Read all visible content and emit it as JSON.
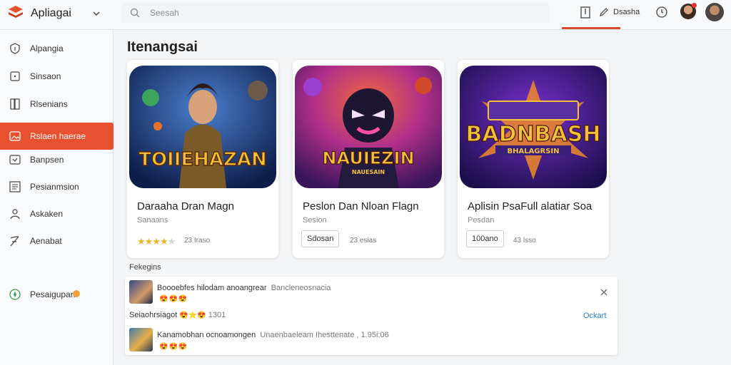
{
  "app": {
    "name": "Apliagai"
  },
  "search": {
    "placeholder": "Seesah"
  },
  "toolbar": {
    "action_label": "Dsasha"
  },
  "sidebar": {
    "items": [
      {
        "label": "Alpangia",
        "icon": "info-shield-icon"
      },
      {
        "label": "Sinsaon",
        "icon": "info-square-icon"
      },
      {
        "label": "Rlsenians",
        "icon": "book-icon"
      },
      {
        "label": "Rslaen haerae",
        "icon": "image-icon",
        "active": true
      },
      {
        "label": "Banpsen",
        "icon": "message-square-icon"
      },
      {
        "label": "Pesianmsion",
        "icon": "document-list-icon"
      },
      {
        "label": "Askaken",
        "icon": "user-icon"
      },
      {
        "label": "Aenabat",
        "icon": "feather-icon"
      },
      {
        "label": "Pesaigupan",
        "icon": "compass-icon"
      }
    ]
  },
  "main": {
    "title": "Itenangsai",
    "cards": [
      {
        "art_title": "TOIIEHAZAN",
        "title": "Daraaha Dran Magn",
        "subtitle": "Sanaans",
        "rating": 3.5,
        "count": "23 Iraso"
      },
      {
        "art_title": "NAUIEZIN",
        "art_subtitle": "NAUESAIN",
        "title": "Peslon Dan Nloan Flagn",
        "subtitle": "Sesion",
        "button": "Sdosan",
        "count": "23 esias"
      },
      {
        "art_title": "BADNBASH",
        "art_subtitle": "BHALAGRSIN",
        "title": "Aplisin PsaFull alatiar Soa",
        "subtitle": "Pesdan",
        "button": "100ano",
        "count": "43 lsso"
      }
    ]
  },
  "trending": {
    "label": "Fekegins",
    "close_icon": "close-icon",
    "update_label": "Ockart",
    "posts": [
      {
        "title": "Boooebfes hilodam anoangrear",
        "meta": "Bancleneosnacia",
        "emojis": "😍😍😍"
      },
      {
        "title": "Seiaohrsiagot",
        "emojis": "😍⭐😍",
        "count": "1301"
      },
      {
        "title": "Kanamobhan ocnoamongen",
        "meta": "Unaenbaeleam Ihesttenate , 1.95i:06",
        "emojis": "😍😍😍"
      }
    ]
  },
  "colors": {
    "accent": "#e8512f",
    "link": "#2b7cc7",
    "star": "#f0b429"
  }
}
